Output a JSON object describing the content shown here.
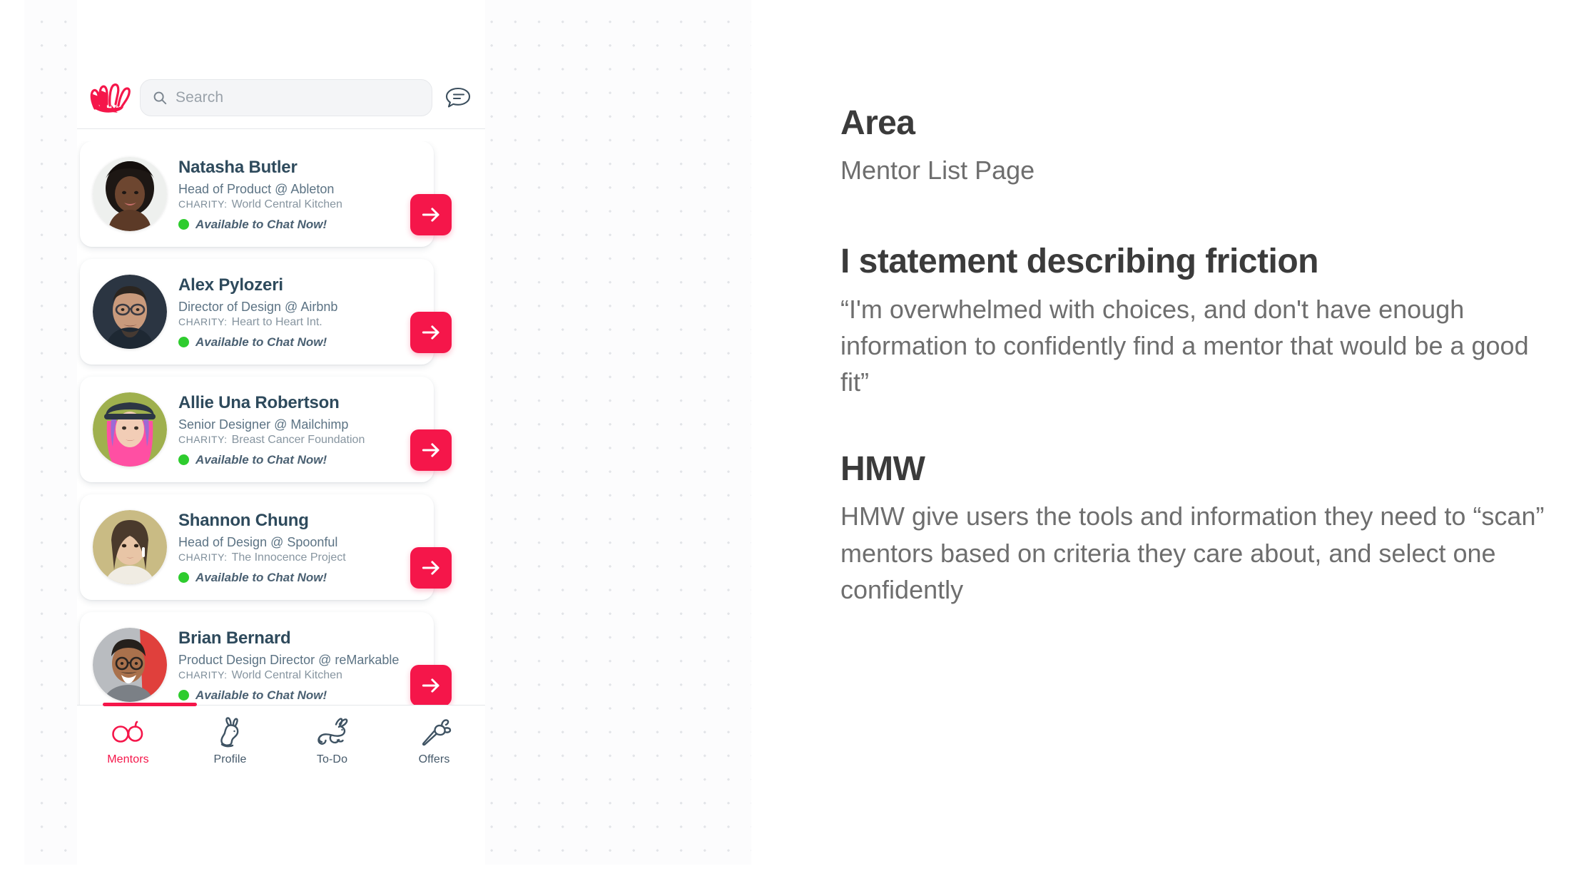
{
  "app": {
    "logo_name": "bunny-hand-logo",
    "brand_color": "#f5164a"
  },
  "search": {
    "placeholder": "Search",
    "value": "",
    "icon": "search-icon"
  },
  "header": {
    "chat_icon": "chat-bubble-icon"
  },
  "mentors": [
    {
      "name": "Natasha Butler",
      "role": "Head of Product @ Ableton",
      "charity_label": "CHARITY:",
      "charity": "World Central Kitchen",
      "status": "Available to Chat Now!",
      "status_color": "#2ecc2e",
      "action": "arrow-right-icon"
    },
    {
      "name": "Alex Pylozeri",
      "role": "Director of Design @ Airbnb",
      "charity_label": "CHARITY:",
      "charity": "Heart to Heart Int.",
      "status": "Available to Chat Now!",
      "status_color": "#2ecc2e",
      "action": "arrow-right-icon"
    },
    {
      "name": "Allie Una Robertson",
      "role": "Senior Designer @ Mailchimp",
      "charity_label": "CHARITY:",
      "charity": "Breast Cancer Foundation",
      "status": "Available to Chat Now!",
      "status_color": "#2ecc2e",
      "action": "arrow-right-icon"
    },
    {
      "name": "Shannon Chung",
      "role": "Head of Design @ Spoonful",
      "charity_label": "CHARITY:",
      "charity": "The Innocence Project",
      "status": "Available to Chat Now!",
      "status_color": "#2ecc2e",
      "action": "arrow-right-icon"
    },
    {
      "name": "Brian Bernard",
      "role": "Product Design Director @ reMarkable",
      "charity_label": "CHARITY:",
      "charity": "World Central Kitchen",
      "status": "Available to Chat Now!",
      "status_color": "#2ecc2e",
      "action": "arrow-right-icon"
    }
  ],
  "bottom_nav": {
    "items": [
      {
        "label": "Mentors",
        "icon": "glasses-icon",
        "active": true
      },
      {
        "label": "Profile",
        "icon": "rabbit-sitting-icon",
        "active": false
      },
      {
        "label": "To-Do",
        "icon": "rabbit-running-icon",
        "active": false
      },
      {
        "label": "Offers",
        "icon": "carrot-icon",
        "active": false
      }
    ]
  },
  "notes": {
    "area_heading": "Area",
    "area_value": "Mentor List Page",
    "friction_heading": "I statement describing friction",
    "friction_body": "“I'm overwhelmed with choices, and don't have enough information to confidently find a mentor that would be a good fit”",
    "hmw_heading": "HMW",
    "hmw_body": "HMW give users the tools and information they need to “scan” mentors based on criteria they care about, and select one confidently"
  }
}
